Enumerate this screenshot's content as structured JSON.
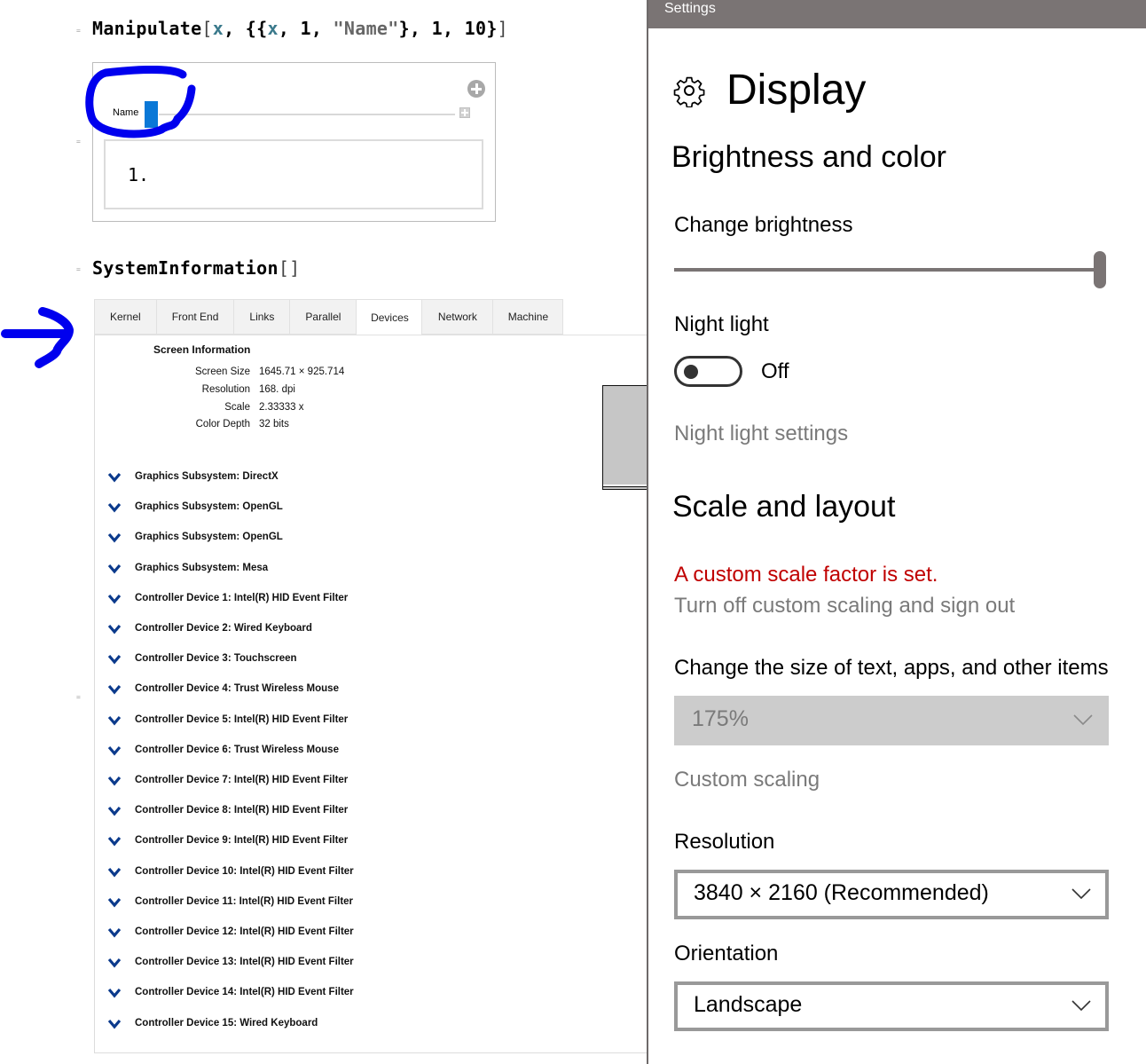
{
  "notebook": {
    "manipulate_input": {
      "head": "Manipulate",
      "open": "[",
      "var1": "x",
      "sep1": ", {{",
      "var2": "x",
      "sep2": ", 1, ",
      "string": "\"Name\"",
      "tail": "}, 1, 10}",
      "close": "]"
    },
    "manipulate_output": {
      "control_label": "Name",
      "slider_value": 1,
      "slider_min": 1,
      "slider_max": 10,
      "result": "1."
    },
    "sysinfo_input": {
      "head": "SystemInformation",
      "brackets": "[]"
    },
    "sysinfo": {
      "tabs": [
        {
          "label": "Kernel",
          "active": false
        },
        {
          "label": "Front End",
          "active": false
        },
        {
          "label": "Links",
          "active": false
        },
        {
          "label": "Parallel",
          "active": false
        },
        {
          "label": "Devices",
          "active": true
        },
        {
          "label": "Network",
          "active": false
        },
        {
          "label": "Machine",
          "active": false
        }
      ],
      "screen_info_title": "Screen Information",
      "screen_info": [
        {
          "key": "Screen Size",
          "value": "1645.71 × 925.714"
        },
        {
          "key": "Resolution",
          "value": "168. dpi"
        },
        {
          "key": "Scale",
          "value": "2.33333 x"
        },
        {
          "key": "Color Depth",
          "value": "32 bits"
        }
      ],
      "devices": [
        "Graphics Subsystem: DirectX",
        "Graphics Subsystem: OpenGL",
        "Graphics Subsystem: OpenGL",
        "Graphics Subsystem: Mesa",
        "Controller Device 1: Intel(R) HID Event Filter",
        "Controller Device 2: Wired Keyboard",
        "Controller Device 3: Touchscreen",
        "Controller Device 4: Trust Wireless Mouse",
        "Controller Device 5: Intel(R) HID Event Filter",
        "Controller Device 6: Trust Wireless Mouse",
        "Controller Device 7: Intel(R) HID Event Filter",
        "Controller Device 8: Intel(R) HID Event Filter",
        "Controller Device 9: Intel(R) HID Event Filter",
        "Controller Device 10: Intel(R) HID Event Filter",
        "Controller Device 11: Intel(R) HID Event Filter",
        "Controller Device 12: Intel(R) HID Event Filter",
        "Controller Device 13: Intel(R) HID Event Filter",
        "Controller Device 14: Intel(R) HID Event Filter",
        "Controller Device 15: Wired Keyboard"
      ]
    },
    "annotation_color": "#0000ee"
  },
  "settings": {
    "window_title": "Settings",
    "page_title": "Display",
    "page_icon": "gear-icon",
    "brightness_section": "Brightness and color",
    "change_brightness_label": "Change brightness",
    "brightness_value_percent": 100,
    "night_light_label": "Night light",
    "night_light_state": "Off",
    "night_light_settings_link": "Night light settings",
    "scale_section": "Scale and layout",
    "custom_scale_warning": "A custom scale factor is set.",
    "turn_off_custom_link": "Turn off custom scaling and sign out",
    "size_label": "Change the size of text, apps, and other items",
    "size_value": "175%",
    "custom_scaling_link": "Custom scaling",
    "resolution_label": "Resolution",
    "resolution_value": "3840 × 2160 (Recommended)",
    "orientation_label": "Orientation",
    "orientation_value": "Landscape",
    "colors": {
      "titlebar": "#7a7474",
      "warning": "#c00000",
      "muted": "#7a7a7a",
      "accent": "#0a78d7"
    }
  }
}
